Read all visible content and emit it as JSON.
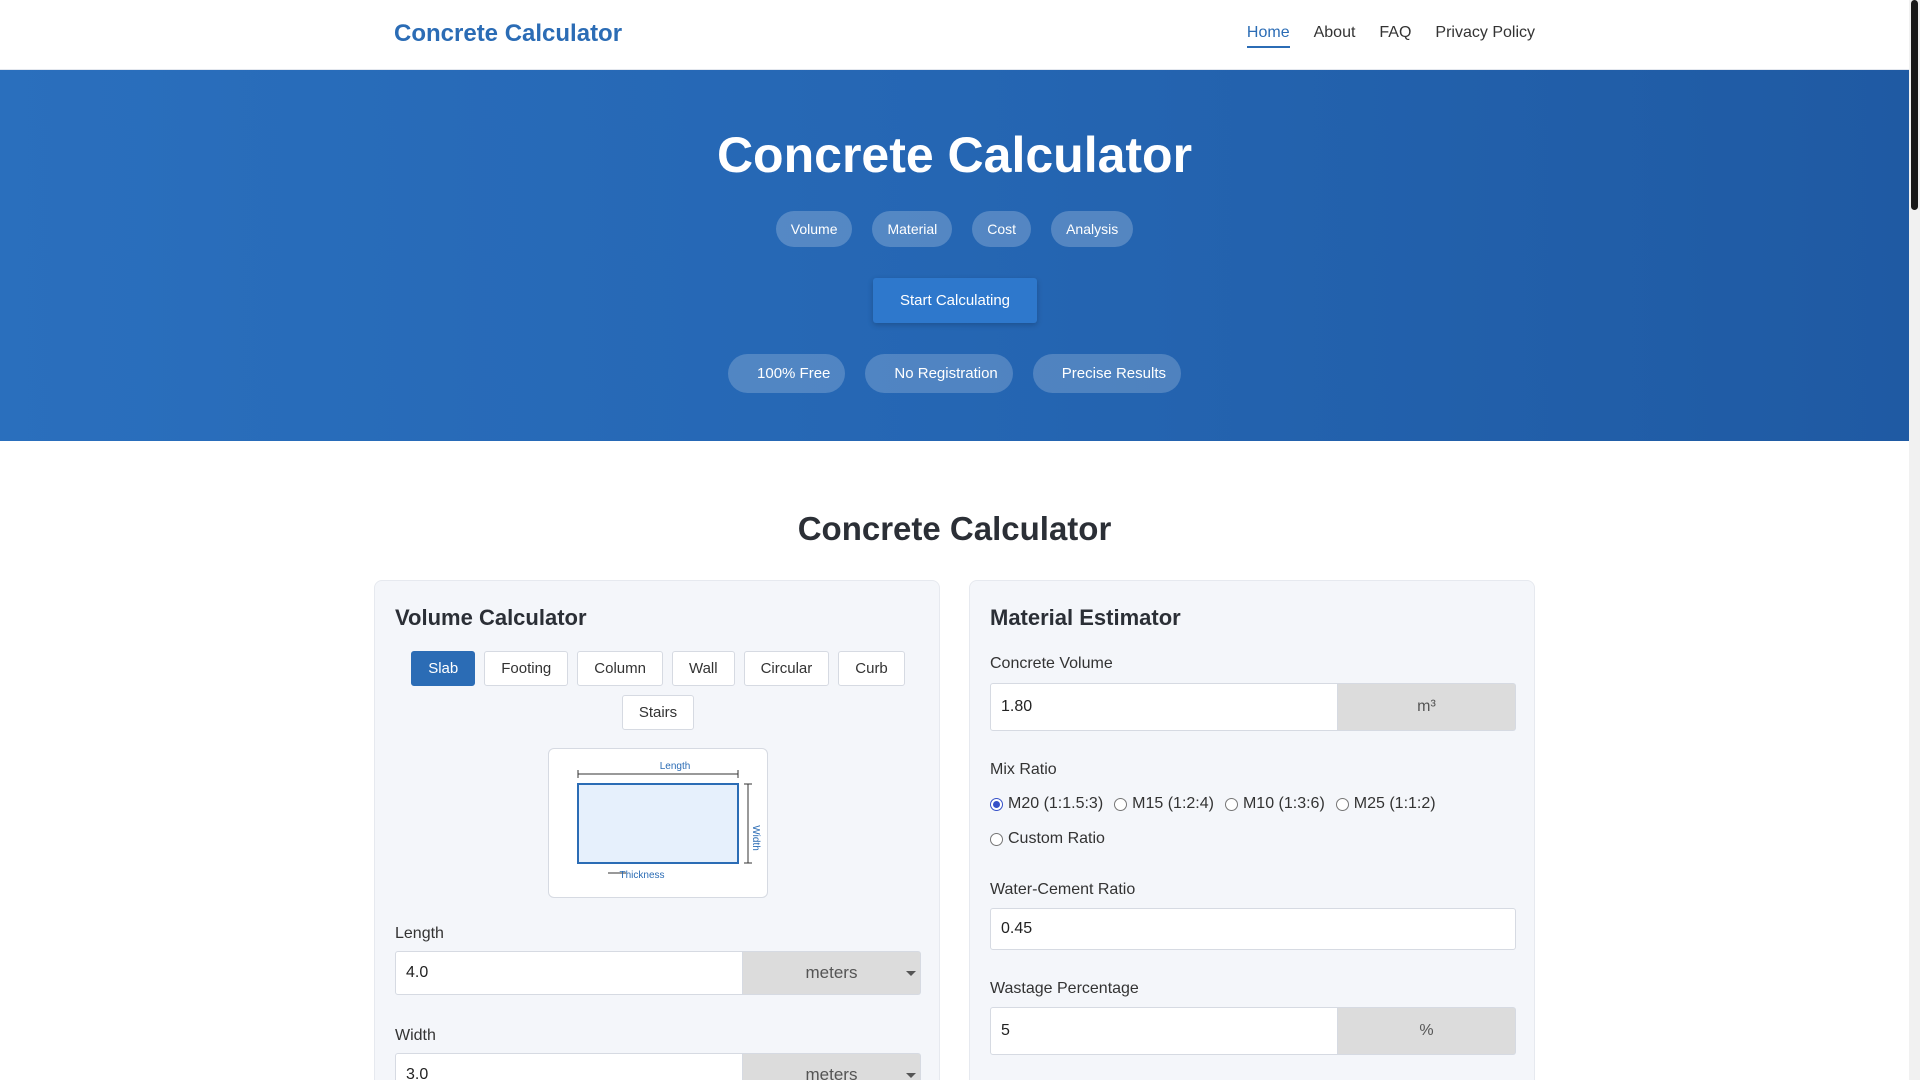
{
  "nav": {
    "brand": "Concrete Calculator",
    "links": [
      {
        "label": "Home"
      },
      {
        "label": "About"
      },
      {
        "label": "FAQ"
      },
      {
        "label": "Privacy Policy"
      }
    ]
  },
  "hero": {
    "title": "Concrete Calculator",
    "tags": [
      "Volume",
      "Material",
      "Cost",
      "Analysis"
    ],
    "cta": "Start Calculating",
    "features": [
      "100% Free",
      "No Registration",
      "Precise Results"
    ]
  },
  "section": {
    "title": "Concrete Calculator"
  },
  "volume": {
    "title": "Volume Calculator",
    "shapes": [
      "Slab",
      "Footing",
      "Column",
      "Wall",
      "Circular",
      "Curb",
      "Stairs"
    ],
    "diagram": {
      "length": "Length",
      "width": "Width",
      "thickness": "Thickness"
    },
    "length": {
      "label": "Length",
      "value": "4.0",
      "unit": "meters"
    },
    "width": {
      "label": "Width",
      "value": "3.0",
      "unit": "meters"
    }
  },
  "material": {
    "title": "Material Estimator",
    "concrete_volume": {
      "label": "Concrete Volume",
      "value": "1.80",
      "unit": "m³"
    },
    "mix_ratio": {
      "label": "Mix Ratio",
      "options": [
        "M20 (1:1.5:3)",
        "M15 (1:2:4)",
        "M10 (1:3:6)",
        "M25 (1:1:2)",
        "Custom Ratio"
      ],
      "selected": "M20 (1:1.5:3)"
    },
    "water_cement": {
      "label": "Water-Cement Ratio",
      "value": "0.45"
    },
    "wastage": {
      "label": "Wastage Percentage",
      "value": "5",
      "unit": "%"
    }
  },
  "colors": {
    "brand": "#2b6cb5",
    "hero": "#2566b3",
    "accent": "#2b6cb5"
  }
}
